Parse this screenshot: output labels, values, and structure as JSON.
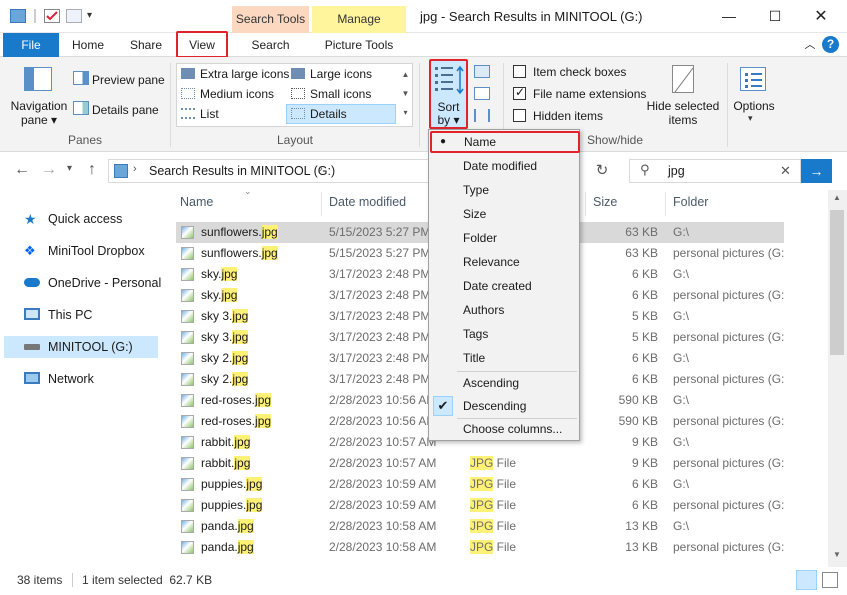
{
  "titlebar": {
    "title": "jpg - Search Results in MINITOOL (G:)",
    "contextual_tabs": [
      "Search Tools",
      "Manage"
    ],
    "buttons": [
      "minimize",
      "maximize",
      "close"
    ]
  },
  "ribbon_tabs": {
    "file": "File",
    "home": "Home",
    "share": "Share",
    "view": "View",
    "search": "Search",
    "picture_tools": "Picture Tools"
  },
  "ribbon": {
    "panes": {
      "navigation_pane": "Navigation pane",
      "preview_pane": "Preview pane",
      "details_pane": "Details pane",
      "group_label": "Panes"
    },
    "layout": {
      "extra_large_icons": "Extra large icons",
      "large_icons": "Large icons",
      "medium_icons": "Medium icons",
      "small_icons": "Small icons",
      "list": "List",
      "details": "Details",
      "group_label": "Layout"
    },
    "current_view": {
      "sort_by": "Sort by"
    },
    "show_hide": {
      "item_check_boxes": "Item check boxes",
      "file_name_extensions": "File name extensions",
      "hidden_items": "Hidden items",
      "hide_selected_items": "Hide selected items",
      "group_label": "Show/hide",
      "item_check_boxes_checked": false,
      "file_name_extensions_checked": true,
      "hidden_items_checked": false
    },
    "options": "Options"
  },
  "address": {
    "path": "Search Results in MINITOOL (G:)",
    "search_value": "jpg"
  },
  "nav_pane": {
    "items": [
      {
        "label": "Quick access"
      },
      {
        "label": "MiniTool Dropbox"
      },
      {
        "label": "OneDrive - Personal"
      },
      {
        "label": "This PC"
      },
      {
        "label": "MINITOOL (G:)"
      },
      {
        "label": "Network"
      }
    ]
  },
  "columns": {
    "name": "Name",
    "date_modified": "Date modified",
    "size": "Size",
    "folder": "Folder"
  },
  "files": [
    {
      "base": "sunflowers.",
      "ext": "jpg",
      "date": "5/15/2023 5:27 PM",
      "type": "",
      "size": "63 KB",
      "folder": "G:\\"
    },
    {
      "base": "sunflowers.",
      "ext": "jpg",
      "date": "5/15/2023 5:27 PM",
      "type": "",
      "size": "63 KB",
      "folder": "personal pictures (G:"
    },
    {
      "base": "sky.",
      "ext": "jpg",
      "date": "3/17/2023 2:48 PM",
      "type": "",
      "size": "6 KB",
      "folder": "G:\\"
    },
    {
      "base": "sky.",
      "ext": "jpg",
      "date": "3/17/2023 2:48 PM",
      "type": "",
      "size": "6 KB",
      "folder": "personal pictures (G:"
    },
    {
      "base": "sky 3.",
      "ext": "jpg",
      "date": "3/17/2023 2:48 PM",
      "type": "",
      "size": "5 KB",
      "folder": "G:\\"
    },
    {
      "base": "sky 3.",
      "ext": "jpg",
      "date": "3/17/2023 2:48 PM",
      "type": "",
      "size": "5 KB",
      "folder": "personal pictures (G:"
    },
    {
      "base": "sky 2.",
      "ext": "jpg",
      "date": "3/17/2023 2:48 PM",
      "type": "",
      "size": "6 KB",
      "folder": "G:\\"
    },
    {
      "base": "sky 2.",
      "ext": "jpg",
      "date": "3/17/2023 2:48 PM",
      "type": "",
      "size": "6 KB",
      "folder": "personal pictures (G:"
    },
    {
      "base": "red-roses.",
      "ext": "jpg",
      "date": "2/28/2023 10:56 AM",
      "type": "",
      "size": "590 KB",
      "folder": "G:\\"
    },
    {
      "base": "red-roses.",
      "ext": "jpg",
      "date": "2/28/2023 10:56 AM",
      "type": "",
      "size": "590 KB",
      "folder": "personal pictures (G:"
    },
    {
      "base": "rabbit.",
      "ext": "jpg",
      "date": "2/28/2023 10:57 AM",
      "type": "",
      "size": "9 KB",
      "folder": "G:\\"
    },
    {
      "base": "rabbit.",
      "ext": "jpg",
      "date": "2/28/2023 10:57 AM",
      "type": "JPG File",
      "size": "9 KB",
      "folder": "personal pictures (G:"
    },
    {
      "base": "puppies.",
      "ext": "jpg",
      "date": "2/28/2023 10:59 AM",
      "type": "JPG File",
      "size": "6 KB",
      "folder": "G:\\"
    },
    {
      "base": "puppies.",
      "ext": "jpg",
      "date": "2/28/2023 10:59 AM",
      "type": "JPG File",
      "size": "6 KB",
      "folder": "personal pictures (G:"
    },
    {
      "base": "panda.",
      "ext": "jpg",
      "date": "2/28/2023 10:58 AM",
      "type": "JPG File",
      "size": "13 KB",
      "folder": "G:\\"
    },
    {
      "base": "panda.",
      "ext": "jpg",
      "date": "2/28/2023 10:58 AM",
      "type": "JPG File",
      "size": "13 KB",
      "folder": "personal pictures (G:"
    }
  ],
  "sort_menu": {
    "items": [
      "Name",
      "Date modified",
      "Type",
      "Size",
      "Folder",
      "Relevance",
      "Date created",
      "Authors",
      "Tags",
      "Title"
    ],
    "selected": "Name",
    "order": [
      "Ascending",
      "Descending"
    ],
    "order_selected": "Descending",
    "choose_columns": "Choose columns..."
  },
  "status": {
    "item_count": "38 items",
    "selection": "1 item selected  62.7 KB"
  },
  "colors": {
    "accent": "#1979ca",
    "highlight_red": "#e0242b",
    "search_tools_tab": "#fbd8bf",
    "manage_tab": "#fff59d",
    "match_highlight": "#fff176"
  }
}
